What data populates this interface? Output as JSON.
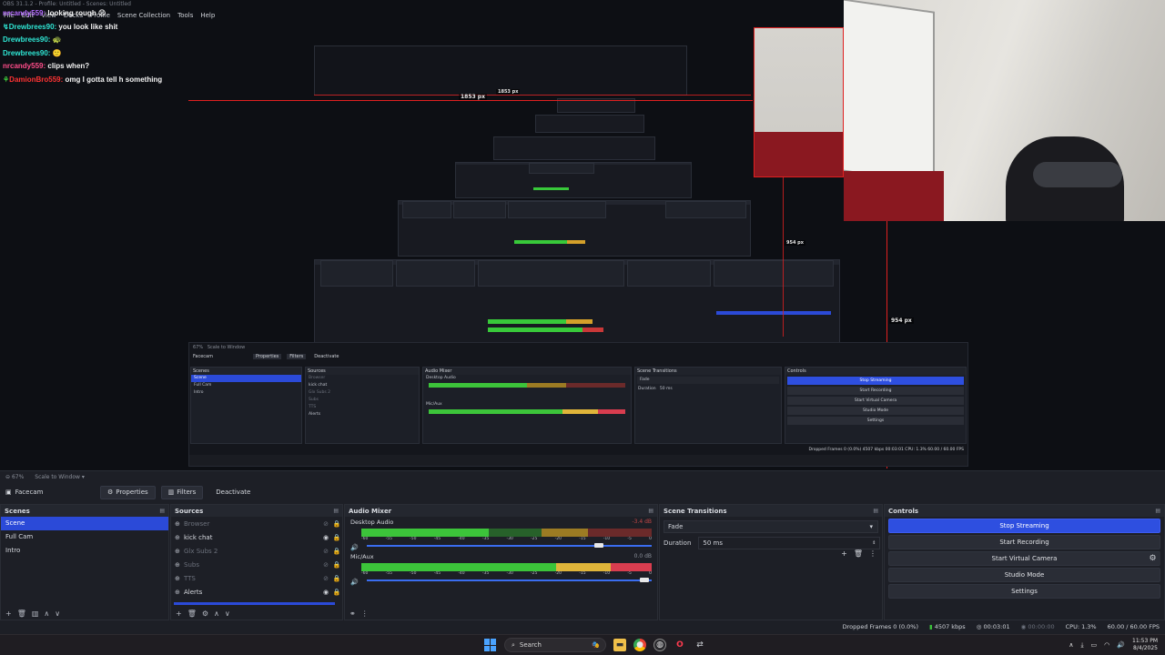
{
  "capture": {
    "title": "OBS 31.1.2 - Profile: Untitled - Scenes: Untitled",
    "menu": [
      "File",
      "Edit",
      "View",
      "Docks",
      "Profile",
      "Scene Collection",
      "Tools",
      "Help"
    ],
    "chat": [
      {
        "user": "nrcandy559:",
        "text": "looking rough ☹",
        "color": "purple",
        "badge": ""
      },
      {
        "user": "Drewbrees90:",
        "text": "you look like shit",
        "color": "cyan",
        "badge": "↯"
      },
      {
        "user": "Drewbrees90:",
        "text": "🐢",
        "color": "cyan",
        "badge": ""
      },
      {
        "user": "Drewbrees90:",
        "text": "🙂",
        "color": "cyan",
        "badge": ""
      },
      {
        "user": "nrcandy559:",
        "text": "clips when?",
        "color": "purple",
        "badge": ""
      },
      {
        "user": "DamionBro559:",
        "text": "omg I gotta tell h something",
        "color": "red",
        "badge": "⚘"
      }
    ],
    "measurements": {
      "width_top": "1853 px",
      "width_inner": "1853 px",
      "height_right": "954 px",
      "height_inner": "954 px"
    },
    "inner_obs": {
      "scene_name": "Facecam",
      "buttons": [
        "Properties",
        "Filters",
        "Deactivate"
      ],
      "docks": [
        "Scenes",
        "Sources",
        "Audio Mixer",
        "Scene Transitions",
        "Controls"
      ],
      "scenes": [
        "Scene",
        "Full Cam",
        "Intro"
      ],
      "sources": [
        "Browser",
        "kick chat",
        "Glx Subs 2",
        "Subs",
        "TTS",
        "Alerts"
      ],
      "mixer": [
        "Desktop Audio",
        "Mic/Aux"
      ],
      "transition": "Fade",
      "duration_label": "Duration",
      "duration": "50 ms",
      "controls": [
        "Stop Streaming",
        "Start Recording",
        "Start Virtual Camera",
        "Studio Mode",
        "Settings"
      ],
      "status": "Dropped Frames 0 (0.0%)   4507 kbps   00:03:01   CPU: 1.3%  60.00 / 60.00 FPS"
    }
  },
  "obs": {
    "zoom": "67%",
    "scale_mode": "Scale to Window",
    "current_scene": "Facecam",
    "toolbar": {
      "properties": "Properties",
      "filters": "Filters",
      "deactivate": "Deactivate"
    },
    "scenes": {
      "title": "Scenes",
      "items": [
        "Scene",
        "Full Cam",
        "Intro"
      ],
      "selected": 0
    },
    "sources": {
      "title": "Sources",
      "items": [
        {
          "name": "Browser",
          "icon": "globe-icon",
          "visible": false
        },
        {
          "name": "kick chat",
          "icon": "globe-icon",
          "visible": true
        },
        {
          "name": "Glx Subs 2",
          "icon": "globe-icon",
          "visible": false
        },
        {
          "name": "Subs",
          "icon": "globe-icon",
          "visible": false
        },
        {
          "name": "TTS",
          "icon": "globe-icon",
          "visible": false
        },
        {
          "name": "Alerts",
          "icon": "globe-icon",
          "visible": true
        }
      ]
    },
    "mixer": {
      "title": "Audio Mixer",
      "channels": [
        {
          "name": "Desktop Audio",
          "db": "-3.4 dB",
          "level": 0.65,
          "fader": 0.84
        },
        {
          "name": "Mic/Aux",
          "db": "0.0 dB",
          "level": 0.9,
          "fader": 1.0
        }
      ],
      "ticks": [
        "-60",
        "-55",
        "-50",
        "-45",
        "-40",
        "-35",
        "-30",
        "-25",
        "-20",
        "-15",
        "-10",
        "-5",
        "0"
      ]
    },
    "transitions": {
      "title": "Scene Transitions",
      "selected": "Fade",
      "duration_label": "Duration",
      "duration": "50 ms"
    },
    "controls": {
      "title": "Controls",
      "buttons": [
        "Stop Streaming",
        "Start Recording",
        "Start Virtual Camera",
        "Studio Mode",
        "Settings"
      ]
    },
    "status": {
      "dropped": "Dropped Frames 0 (0.0%)",
      "bitrate": "4507 kbps",
      "stream_time": "00:03:01",
      "rec_time": "00:00:00",
      "cpu": "CPU: 1.3%",
      "fps": "60.00 / 60.00 FPS"
    }
  },
  "taskbar": {
    "search_placeholder": "Search",
    "time": "11:53 PM",
    "date": "8/4/2025"
  },
  "colors": {
    "accent": "#2e4fe0",
    "selection": "#2b4ad8",
    "meter_green": "#3cc43a",
    "meter_yellow": "#e0b53a",
    "meter_red": "#d93d4f",
    "measure_line": "#e02020"
  }
}
